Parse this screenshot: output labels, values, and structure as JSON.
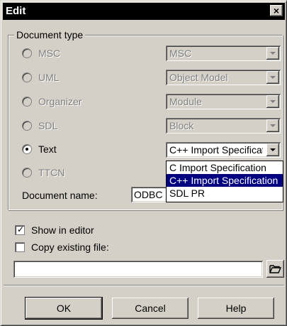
{
  "window": {
    "title": "Edit",
    "close_label": "×"
  },
  "document_type": {
    "legend": "Document type",
    "options": [
      {
        "label": "MSC",
        "combo_value": "MSC",
        "enabled": false,
        "selected": false
      },
      {
        "label": "UML",
        "combo_value": "Object Model",
        "enabled": false,
        "selected": false
      },
      {
        "label": "Organizer",
        "combo_value": "Module",
        "enabled": false,
        "selected": false
      },
      {
        "label": "SDL",
        "combo_value": "Block",
        "enabled": false,
        "selected": false
      },
      {
        "label": "Text",
        "combo_value": "C++ Import Specification",
        "enabled": true,
        "selected": true
      },
      {
        "label": "TTCN",
        "combo_value": "",
        "enabled": false,
        "selected": false
      }
    ],
    "dropdown_items": [
      {
        "label": "C Import Specification",
        "highlighted": false
      },
      {
        "label": "C++ Import Specification",
        "highlighted": true
      },
      {
        "label": "SDL PR",
        "highlighted": false
      }
    ],
    "document_name_label": "Document name:",
    "document_name_value": "ODBC"
  },
  "options": {
    "show_in_editor": {
      "label": "Show in editor",
      "checked": true
    },
    "copy_existing_file": {
      "label": "Copy existing file:",
      "checked": false
    },
    "file_path_value": "",
    "browse_icon": "folder-open-icon"
  },
  "buttons": {
    "ok": "OK",
    "cancel": "Cancel",
    "help": "Help"
  },
  "colors": {
    "highlight": "#000080",
    "dialog_bg": "#d4d0c8",
    "titlebar": "#000000"
  }
}
